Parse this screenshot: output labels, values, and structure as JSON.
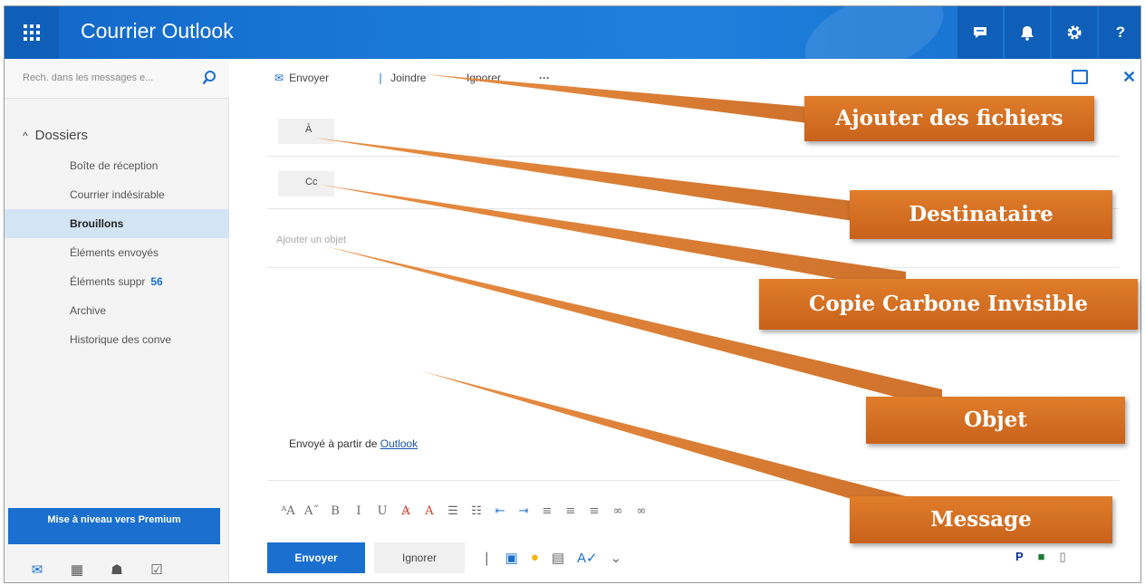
{
  "header": {
    "app_title": "Courrier Outlook",
    "buttons": [
      "chat-icon",
      "bell-icon",
      "gear-icon",
      "help-icon"
    ],
    "help_glyph": "?",
    "accent": "#1a6fcf"
  },
  "sidebar": {
    "search_placeholder": "Rech. dans les messages e...",
    "folders_label": "Dossiers",
    "folders": [
      {
        "label": "Boîte de réception",
        "count": ""
      },
      {
        "label": "Courrier indésirable",
        "count": ""
      },
      {
        "label": "Brouillons",
        "count": "",
        "active": true
      },
      {
        "label": "Éléments envoyés",
        "count": ""
      },
      {
        "label": "Éléments suppr",
        "count": "56"
      },
      {
        "label": "Archive",
        "count": ""
      },
      {
        "label": "Historique des conve",
        "count": ""
      }
    ],
    "premium_button": "Mise à niveau vers Premium",
    "bottom_nav": [
      "mail-icon",
      "calendar-icon",
      "people-icon",
      "tasks-icon"
    ]
  },
  "compose": {
    "toolbar": {
      "send": "Envoyer",
      "attach": "Joindre",
      "discard": "Ignorer",
      "more": "···"
    },
    "to_label": "À",
    "cc_label": "Cc",
    "subject_placeholder": "Ajouter un objet",
    "signature_prefix": "Envoyé à partir de",
    "signature_link": "Outlook",
    "send_button": "Envoyer",
    "ignore_button": "Ignorer"
  },
  "callouts": {
    "attach_files": "Ajouter des fichiers",
    "recipient": "Destinataire",
    "bcc": "Copie Carbone Invisible",
    "subject": "Objet",
    "message": "Message",
    "color": "#d06f22"
  }
}
